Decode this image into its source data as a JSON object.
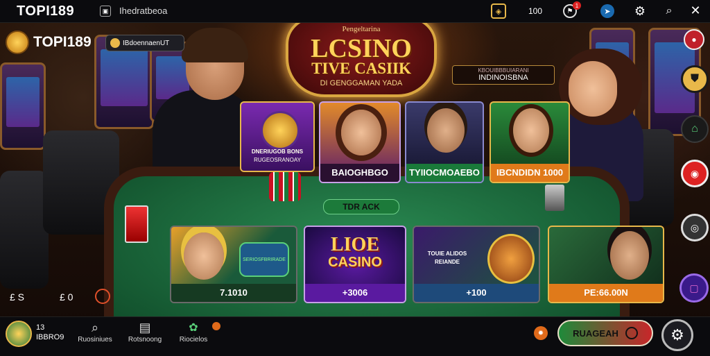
{
  "topbar": {
    "brand": "TOPI189",
    "site_label": "Ihedratbeoa",
    "counter": "100",
    "notif_count": "1"
  },
  "header": {
    "brand": "TOPI189",
    "pill": "IBdoennaenUT"
  },
  "sign": {
    "line1": "Pengeltarina",
    "line2": "LCSINO",
    "line3": "TIVE CASIIK",
    "line4": "DI GENGGAMAN YADA"
  },
  "badge": {
    "small": "KBOUIBBBUIARANI",
    "main": "INDINOISBNA"
  },
  "mini_cards": [
    {
      "label1": "DNERIUGOB BONS",
      "label2": "RUGEOSRANOAY"
    },
    {
      "caption": "BAIOGHBGO"
    },
    {
      "caption": "TYIIOCMOAEBO"
    },
    {
      "caption": "IBCNDIDN 1000"
    }
  ],
  "table_button": "TDR ACK",
  "cards": [
    {
      "caption": "7.1010",
      "sub": "SERIOSFBRIRADE"
    },
    {
      "title1": "LIOE",
      "title2": "CASINO",
      "caption": "+3006"
    },
    {
      "text1": "TOUIE ALIDOS",
      "text2": "REIANDE",
      "caption": "+100"
    },
    {
      "caption": "PE:66.00N"
    }
  ],
  "side_left": {
    "a": "£ S",
    "b": "£ 0"
  },
  "bottom": {
    "profile_top": "13",
    "profile_bottom": "IBBRO9",
    "nav": [
      "Ruosiniues",
      "Rotsnoong",
      "Riocielos"
    ],
    "main_button": "RUAGEAH"
  }
}
